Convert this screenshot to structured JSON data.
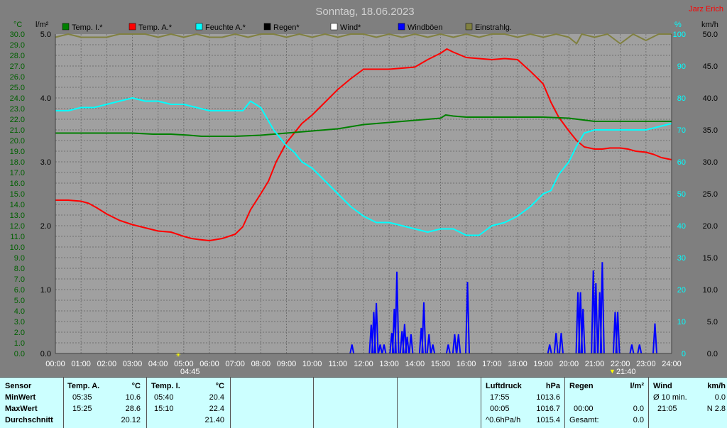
{
  "title": "Sonntag, 18.06.2023",
  "brand": "Jarz Erich",
  "axes": {
    "left1_unit": "°C",
    "left2_unit": "l/m²",
    "right1_unit": "%",
    "right2_unit": "km/h",
    "temp_ticks": [
      "0.0",
      "1.0",
      "2.0",
      "3.0",
      "4.0",
      "5.0",
      "6.0",
      "7.0",
      "8.0",
      "9.0",
      "10.0",
      "11.0",
      "12.0",
      "13.0",
      "14.0",
      "15.0",
      "16.0",
      "17.0",
      "18.0",
      "19.0",
      "20.0",
      "21.0",
      "22.0",
      "23.0",
      "24.0",
      "25.0",
      "26.0",
      "27.0",
      "28.0",
      "29.0",
      "30.0"
    ],
    "rain_ticks": [
      "0.0",
      "1.0",
      "2.0",
      "3.0",
      "4.0",
      "5.0"
    ],
    "hum_ticks": [
      "0",
      "10",
      "20",
      "30",
      "40",
      "50",
      "60",
      "70",
      "80",
      "90",
      "100"
    ],
    "wind_ticks": [
      "0.0",
      "5.0",
      "10.0",
      "15.0",
      "20.0",
      "25.0",
      "30.0",
      "35.0",
      "40.0",
      "45.0",
      "50.0"
    ],
    "time_ticks": [
      "00:00",
      "01:00",
      "02:00",
      "03:00",
      "04:00",
      "05:00",
      "06:00",
      "07:00",
      "08:00",
      "09:00",
      "10:00",
      "11:00",
      "12:00",
      "13:00",
      "14:00",
      "15:00",
      "16:00",
      "17:00",
      "18:00",
      "19:00",
      "20:00",
      "21:00",
      "22:00",
      "23:00",
      "24:00"
    ],
    "sunrise": "04:45",
    "sunset": "21:40"
  },
  "legend": [
    {
      "label": "Temp. I.*",
      "color": "#008000"
    },
    {
      "label": "Temp. A.*",
      "color": "#ff0000"
    },
    {
      "label": "Feuchte A.*",
      "color": "#00ffff"
    },
    {
      "label": "Regen*",
      "color": "#000000"
    },
    {
      "label": "Wind*",
      "color": "#ffffff"
    },
    {
      "label": "Windböen",
      "color": "#0000ff"
    },
    {
      "label": "Einstrahlg.",
      "color": "#808040"
    }
  ],
  "chart_data": {
    "type": "line",
    "title": "Sonntag, 18.06.2023",
    "x_unit": "hour",
    "xlim": [
      0,
      24
    ],
    "temp_ylim": [
      0,
      30
    ],
    "hum_ylim": [
      0,
      100
    ],
    "wind_ylim": [
      0,
      50
    ],
    "rain_ylim": [
      0,
      5
    ],
    "grid": true,
    "series": [
      {
        "name": "Temp. A.*",
        "axis": "temp",
        "color": "#ff0000",
        "x": [
          0,
          0.5,
          1,
          1.3,
          1.6,
          2,
          2.5,
          3,
          3.5,
          4,
          4.5,
          5,
          5.3,
          5.6,
          6,
          6.5,
          7,
          7.3,
          7.6,
          8,
          8.3,
          8.6,
          9,
          9.3,
          9.6,
          10,
          10.5,
          11,
          11.5,
          12,
          12.5,
          13,
          13.5,
          14,
          14.5,
          15,
          15.25,
          15.5,
          16,
          16.5,
          17,
          17.5,
          18,
          18.5,
          18.8,
          19,
          19.3,
          19.6,
          20,
          20.3,
          20.6,
          21,
          21.3,
          21.6,
          22,
          22.3,
          22.6,
          23,
          23.3,
          23.6,
          24
        ],
        "y": [
          14.4,
          14.4,
          14.3,
          14.1,
          13.7,
          13.1,
          12.5,
          12.1,
          11.8,
          11.5,
          11.4,
          11.0,
          10.8,
          10.7,
          10.6,
          10.8,
          11.2,
          11.9,
          13.5,
          15.0,
          16.2,
          18.0,
          19.8,
          20.7,
          21.6,
          22.4,
          23.6,
          24.8,
          25.8,
          26.7,
          26.7,
          26.7,
          26.8,
          26.9,
          27.6,
          28.2,
          28.6,
          28.3,
          27.8,
          27.7,
          27.6,
          27.7,
          27.6,
          26.5,
          25.8,
          25.3,
          23.6,
          22.2,
          20.9,
          20.0,
          19.4,
          19.2,
          19.2,
          19.3,
          19.3,
          19.2,
          19.0,
          18.9,
          18.7,
          18.4,
          18.2
        ]
      },
      {
        "name": "Temp. I.*",
        "axis": "temp",
        "color": "#008000",
        "x": [
          0,
          1,
          2,
          3,
          3.8,
          4.5,
          5.2,
          5.7,
          6,
          7,
          8,
          9,
          10,
          11,
          12,
          13,
          14,
          15,
          15.2,
          15.5,
          16,
          17,
          18,
          19,
          20,
          21,
          22,
          23,
          24
        ],
        "y": [
          20.7,
          20.7,
          20.7,
          20.7,
          20.6,
          20.6,
          20.5,
          20.4,
          20.4,
          20.4,
          20.5,
          20.7,
          20.9,
          21.1,
          21.5,
          21.7,
          21.9,
          22.1,
          22.4,
          22.3,
          22.2,
          22.2,
          22.2,
          22.2,
          22.1,
          21.8,
          21.8,
          21.8,
          21.8
        ]
      },
      {
        "name": "Feuchte A.*",
        "axis": "hum",
        "color": "#00ffff",
        "x": [
          0,
          0.5,
          1,
          1.5,
          2,
          2.5,
          3,
          3.5,
          4,
          4.5,
          5,
          5.5,
          6,
          6.5,
          7,
          7.3,
          7.6,
          8,
          8.5,
          9,
          9.3,
          9.6,
          10,
          10.5,
          11,
          11.5,
          12,
          12.5,
          13,
          13.5,
          14,
          14.5,
          15,
          15.5,
          16,
          16.5,
          17,
          17.5,
          18,
          18.5,
          19,
          19.3,
          19.6,
          20,
          20.3,
          20.6,
          21,
          21.5,
          22,
          22.5,
          23,
          23.5,
          24
        ],
        "y": [
          76,
          76,
          77,
          77,
          78,
          79,
          80,
          79,
          79,
          78,
          78,
          77,
          76,
          76,
          76,
          76,
          79,
          77,
          70,
          65,
          63,
          60,
          58,
          54,
          50,
          46,
          43,
          41,
          41,
          40,
          39,
          38,
          39,
          39,
          37,
          37,
          40,
          41,
          43,
          46,
          50,
          51,
          56,
          60,
          65,
          69,
          70,
          70,
          70,
          70,
          70,
          71,
          72
        ]
      },
      {
        "name": "Windböen",
        "axis": "wind",
        "color": "#0000ff",
        "style": "bars",
        "x": [
          11.55,
          12.3,
          12.4,
          12.5,
          12.65,
          12.8,
          13.1,
          13.2,
          13.3,
          13.5,
          13.6,
          13.7,
          13.85,
          14.25,
          14.35,
          14.55,
          14.7,
          15.3,
          15.55,
          15.7,
          16.05,
          19.25,
          19.5,
          19.7,
          20.35,
          20.45,
          20.55,
          20.95,
          21.05,
          21.2,
          21.3,
          21.8,
          21.9,
          22.45,
          22.75,
          23.35
        ],
        "y": [
          1.4,
          4.5,
          6.5,
          7.9,
          1.4,
          1.4,
          3.2,
          7.0,
          12.8,
          3.5,
          4.6,
          2.6,
          3.0,
          4.0,
          8.0,
          3.0,
          1.4,
          1.4,
          3.0,
          3.0,
          11.2,
          1.4,
          3.2,
          3.2,
          9.6,
          9.6,
          7.0,
          13.0,
          11.0,
          9.6,
          14.3,
          6.5,
          6.5,
          1.4,
          1.4,
          4.7
        ]
      },
      {
        "name": "Einstrahlg.",
        "axis": "hum",
        "color": "#808040",
        "x": [
          0,
          0.5,
          1,
          1.5,
          2,
          2.5,
          3,
          3.5,
          4,
          4.5,
          5,
          5.5,
          6,
          6.5,
          7,
          7.5,
          8,
          8.5,
          9,
          9.5,
          10,
          10.5,
          11,
          11.5,
          12,
          12.5,
          13,
          13.5,
          14,
          14.5,
          15,
          15.5,
          16,
          16.5,
          17,
          17.5,
          18,
          18.5,
          19,
          19.5,
          20,
          20.3,
          20.5,
          21,
          21.5,
          22,
          22.5,
          23,
          23.5,
          24
        ],
        "y": [
          99,
          100,
          99,
          99,
          99,
          100,
          100,
          100,
          99,
          100,
          99,
          100,
          99,
          99,
          100,
          99,
          100,
          100,
          99,
          100,
          99,
          100,
          99,
          100,
          100,
          99,
          100,
          99,
          100,
          99,
          100,
          99,
          100,
          99,
          100,
          100,
          99,
          100,
          99,
          100,
          99,
          97,
          100,
          99,
          100,
          97,
          100,
          98,
          100,
          100
        ]
      }
    ]
  },
  "footer": {
    "sensor": {
      "header": "Sensor",
      "rows": [
        "MinWert",
        "MaxWert",
        "Durchschnitt"
      ]
    },
    "temp_a": {
      "header": "Temp. A.",
      "unit": "°C",
      "min_time": "05:35",
      "min_val": "10.6",
      "max_time": "15:25",
      "max_val": "28.6",
      "avg": "20.12"
    },
    "temp_i": {
      "header": "Temp. I.",
      "unit": "°C",
      "min_time": "05:40",
      "min_val": "20.4",
      "max_time": "15:10",
      "max_val": "22.4",
      "avg": "21.40"
    },
    "pressure": {
      "header": "Luftdruck",
      "unit": "hPa",
      "r1_time": "17:55",
      "r1_val": "1013.6",
      "r2_time": "00:05",
      "r2_val": "1016.7",
      "r3_time": "^0.6hPa/h",
      "r3_val": "1015.4"
    },
    "rain": {
      "header": "Regen",
      "unit": "l/m²",
      "r2_time": "00:00",
      "r2_val": "0.0",
      "r3_label": "Gesamt:",
      "r3_val": "0.0"
    },
    "wind": {
      "header": "Wind",
      "unit": "km/h",
      "r1_label": "Ø 10 min.",
      "r1_val": "0.0",
      "r2_time": "21:05",
      "r2_val": "N 2.8"
    }
  }
}
